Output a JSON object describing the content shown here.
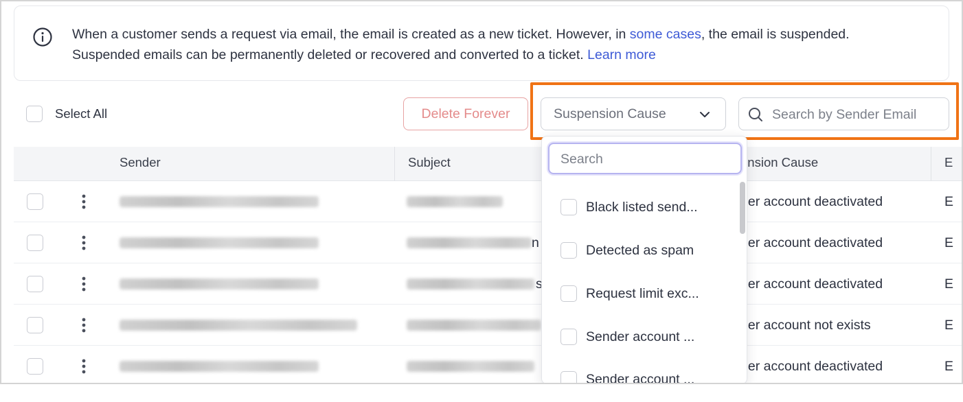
{
  "banner": {
    "text_before": "When a customer sends a request via email, the email is created as a new ticket. However, in ",
    "link_some_cases": "some cases",
    "text_middle": ", the email is suspended. Suspended emails can be permanently deleted or recovered and converted to a ticket. ",
    "link_learn_more": "Learn more",
    "icon": "info-icon"
  },
  "toolbar": {
    "select_all_label": "Select All",
    "delete_label": "Delete Forever",
    "cause_select_placeholder": "Suspension Cause",
    "search_placeholder": "Search by Sender Email"
  },
  "table": {
    "columns": [
      "Sender",
      "Subject",
      "Suspension Cause",
      "E"
    ],
    "cause_header_visible": "ension Cause",
    "rows": [
      {
        "subject_tail": "",
        "cause_visible": "der account deactivated",
        "trail": "E"
      },
      {
        "subject_tail": "n",
        "cause_visible": "der account deactivated",
        "trail": "E"
      },
      {
        "subject_tail": "s",
        "cause_visible": "der account deactivated",
        "trail": "E"
      },
      {
        "subject_tail": "",
        "cause_visible": "der account not exists",
        "trail": "E"
      },
      {
        "subject_tail": "",
        "cause_visible": "der account deactivated",
        "trail": "E"
      }
    ]
  },
  "dropdown": {
    "search_placeholder": "Search",
    "options": [
      "Black listed send...",
      "Detected as spam",
      "Request limit exc...",
      "Sender account ...",
      "Sender account ..."
    ]
  },
  "colors": {
    "link": "#3d5ad6",
    "highlight": "#f07315",
    "delete_text": "#e48b8b",
    "focus_ring": "#b6b4f0"
  }
}
